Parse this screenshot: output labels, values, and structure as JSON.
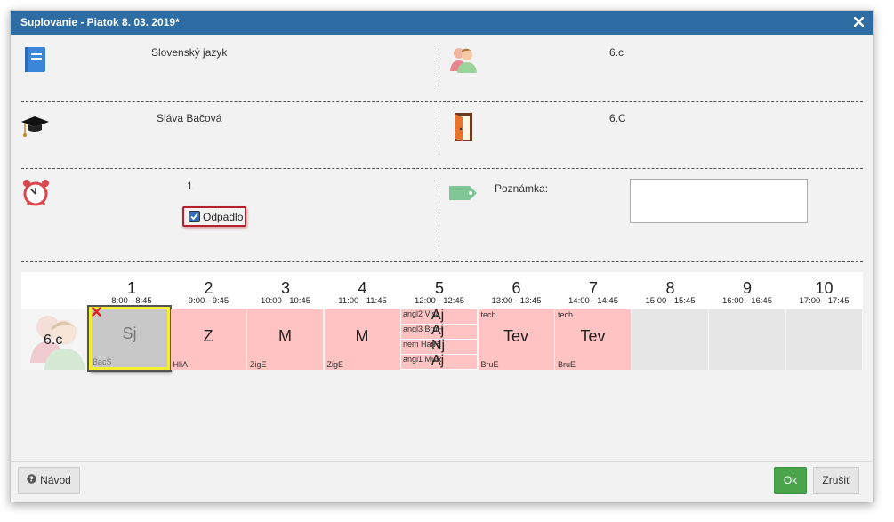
{
  "dialog": {
    "title": "Suplovanie - Piatok 8. 03. 2019*"
  },
  "info": {
    "subject": "Slovenský jazyk",
    "class": "6.c",
    "teacher": "Sláva Bačová",
    "room": "6.C",
    "period": "1",
    "cancelled_label": "Odpadlo",
    "cancelled_checked": true,
    "note_label": "Poznámka:",
    "note_value": ""
  },
  "timetable": {
    "class_label": "6.c",
    "periods": [
      {
        "num": "1",
        "time": "8:00 - 8:45"
      },
      {
        "num": "2",
        "time": "9:00 - 9:45"
      },
      {
        "num": "3",
        "time": "10:00 - 10:45"
      },
      {
        "num": "4",
        "time": "11:00 - 11:45"
      },
      {
        "num": "5",
        "time": "12:00 - 12:45"
      },
      {
        "num": "6",
        "time": "13:00 - 13:45"
      },
      {
        "num": "7",
        "time": "14:00 - 14:45"
      },
      {
        "num": "8",
        "time": "15:00 - 15:45"
      },
      {
        "num": "9",
        "time": "16:00 - 16:45"
      },
      {
        "num": "10",
        "time": "17:00 - 17:45"
      }
    ],
    "lessons": [
      {
        "subject": "Sj",
        "teacher": "BacS",
        "group": "",
        "state": "selected"
      },
      {
        "subject": "Z",
        "teacher": "HliA",
        "group": "",
        "state": "pink"
      },
      {
        "subject": "M",
        "teacher": "ZigE",
        "group": "",
        "state": "pink"
      },
      {
        "subject": "M",
        "teacher": "ZigE",
        "group": "",
        "state": "pink"
      },
      {
        "subject": "",
        "teacher": "",
        "group": "",
        "state": "split",
        "parts": [
          {
            "group": "angl2 VisL",
            "subject": "Aj"
          },
          {
            "group": "angl3 BruH",
            "subject": "Aj"
          },
          {
            "group": "nem HarR",
            "subject": "Nj"
          },
          {
            "group": "angl1 MuR",
            "subject": "Aj"
          }
        ]
      },
      {
        "subject": "Tev",
        "teacher": "BruE",
        "group": "tech",
        "state": "pink"
      },
      {
        "subject": "Tev",
        "teacher": "BruE",
        "group": "tech",
        "state": "pink"
      },
      {
        "subject": "",
        "teacher": "",
        "group": "",
        "state": "empty"
      },
      {
        "subject": "",
        "teacher": "",
        "group": "",
        "state": "empty"
      },
      {
        "subject": "",
        "teacher": "",
        "group": "",
        "state": "empty"
      }
    ]
  },
  "footer": {
    "help_label": "Návod",
    "ok_label": "Ok",
    "cancel_label": "Zrušiť"
  },
  "colors": {
    "titlebar": "#2e6da4",
    "lesson": "#ffc3c3",
    "ok": "#4aa44a",
    "highlight": "#b7202b"
  },
  "icons": [
    "book-icon",
    "users-icon",
    "graduation-cap-icon",
    "door-icon",
    "alarm-clock-icon",
    "tag-icon",
    "close-icon",
    "help-icon",
    "cancel-x-icon",
    "student-avatar-icon"
  ]
}
